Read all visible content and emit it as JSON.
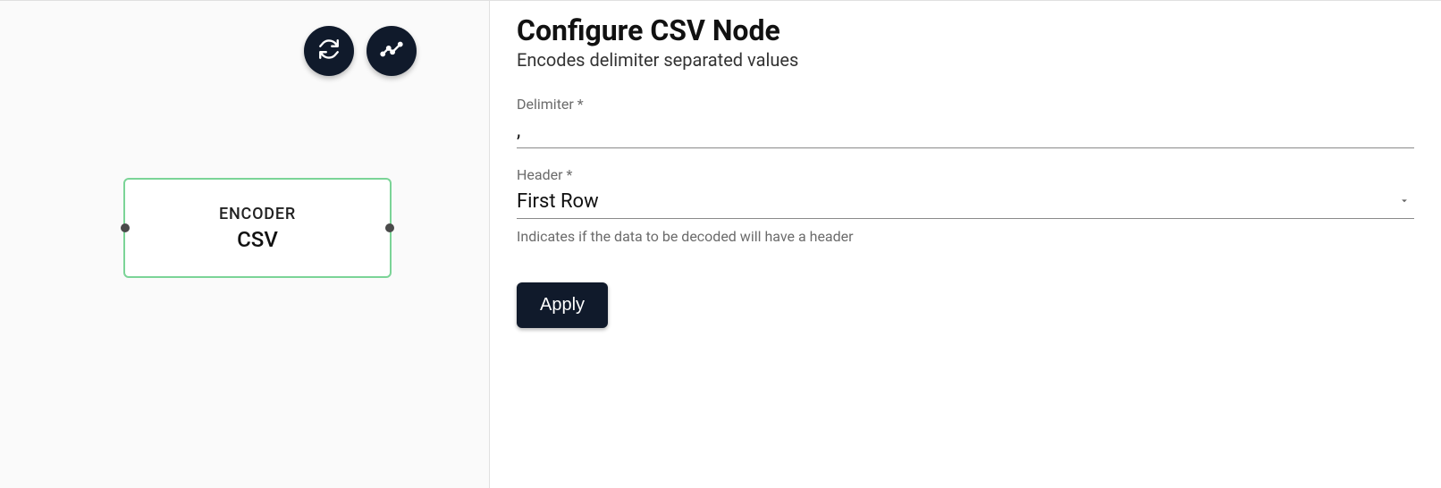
{
  "canvas": {
    "node": {
      "type_label": "ENCODER",
      "name": "CSV"
    }
  },
  "config": {
    "title": "Configure CSV Node",
    "subtitle": "Encodes delimiter separated values",
    "delimiter": {
      "label": "Delimiter *",
      "value": ","
    },
    "header": {
      "label": "Header *",
      "value": "First Row",
      "hint": "Indicates if the data to be decoded will have a header"
    },
    "apply_label": "Apply"
  }
}
